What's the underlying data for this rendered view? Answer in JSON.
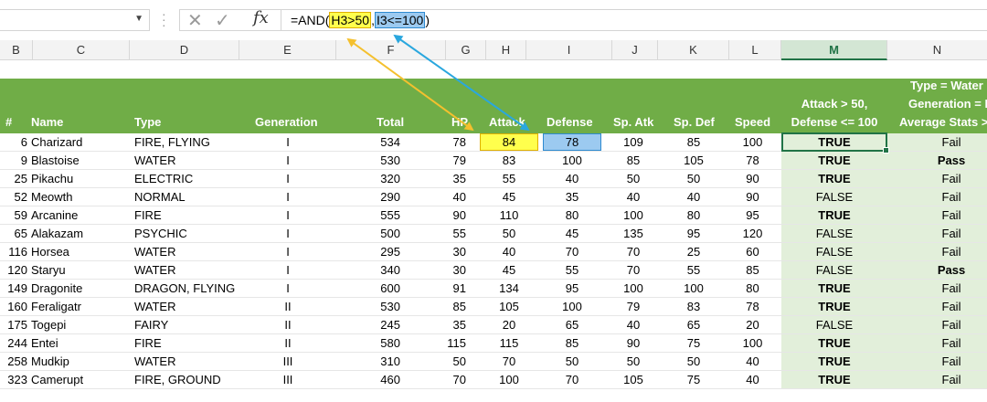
{
  "formula_bar": {
    "name_box": "",
    "formula_prefix": "=AND(",
    "ref1": "H3>50",
    "sep": ",",
    "ref2": "I3<=100",
    "formula_suffix": ")",
    "cancel_icon": "cancel-icon",
    "enter_icon": "checkmark-icon",
    "fx_label": "fx"
  },
  "columns": [
    "B",
    "C",
    "D",
    "E",
    "F",
    "G",
    "H",
    "I",
    "J",
    "K",
    "L",
    "M",
    "N"
  ],
  "header": {
    "num": "#",
    "name": "Name",
    "type": "Type",
    "generation": "Generation",
    "total": "Total",
    "hp": "HP",
    "attack": "Attack",
    "defense": "Defense",
    "sp_atk": "Sp. Atk",
    "sp_def": "Sp. Def",
    "speed": "Speed",
    "m_line1": "Attack > 50,",
    "m_line2": "Defense <= 100",
    "n_line1": "Type = Water",
    "n_line2": "Generation = I",
    "n_line3": "Average Stats >"
  },
  "rows": [
    {
      "num": "6",
      "name": "Charizard",
      "type": "FIRE, FLYING",
      "gen": "I",
      "total": "534",
      "hp": "78",
      "atk": "84",
      "def": "78",
      "spatk": "109",
      "spdef": "85",
      "speed": "100",
      "m": "TRUE",
      "n": "Fail"
    },
    {
      "num": "9",
      "name": "Blastoise",
      "type": "WATER",
      "gen": "I",
      "total": "530",
      "hp": "79",
      "atk": "83",
      "def": "100",
      "spatk": "85",
      "spdef": "105",
      "speed": "78",
      "m": "TRUE",
      "n": "Pass"
    },
    {
      "num": "25",
      "name": "Pikachu",
      "type": "ELECTRIC",
      "gen": "I",
      "total": "320",
      "hp": "35",
      "atk": "55",
      "def": "40",
      "spatk": "50",
      "spdef": "50",
      "speed": "90",
      "m": "TRUE",
      "n": "Fail"
    },
    {
      "num": "52",
      "name": "Meowth",
      "type": "NORMAL",
      "gen": "I",
      "total": "290",
      "hp": "40",
      "atk": "45",
      "def": "35",
      "spatk": "40",
      "spdef": "40",
      "speed": "90",
      "m": "FALSE",
      "n": "Fail"
    },
    {
      "num": "59",
      "name": "Arcanine",
      "type": "FIRE",
      "gen": "I",
      "total": "555",
      "hp": "90",
      "atk": "110",
      "def": "80",
      "spatk": "100",
      "spdef": "80",
      "speed": "95",
      "m": "TRUE",
      "n": "Fail"
    },
    {
      "num": "65",
      "name": "Alakazam",
      "type": "PSYCHIC",
      "gen": "I",
      "total": "500",
      "hp": "55",
      "atk": "50",
      "def": "45",
      "spatk": "135",
      "spdef": "95",
      "speed": "120",
      "m": "FALSE",
      "n": "Fail"
    },
    {
      "num": "116",
      "name": "Horsea",
      "type": "WATER",
      "gen": "I",
      "total": "295",
      "hp": "30",
      "atk": "40",
      "def": "70",
      "spatk": "70",
      "spdef": "25",
      "speed": "60",
      "m": "FALSE",
      "n": "Fail"
    },
    {
      "num": "120",
      "name": "Staryu",
      "type": "WATER",
      "gen": "I",
      "total": "340",
      "hp": "30",
      "atk": "45",
      "def": "55",
      "spatk": "70",
      "spdef": "55",
      "speed": "85",
      "m": "FALSE",
      "n": "Pass"
    },
    {
      "num": "149",
      "name": "Dragonite",
      "type": "DRAGON, FLYING",
      "gen": "I",
      "total": "600",
      "hp": "91",
      "atk": "134",
      "def": "95",
      "spatk": "100",
      "spdef": "100",
      "speed": "80",
      "m": "TRUE",
      "n": "Fail"
    },
    {
      "num": "160",
      "name": "Feraligatr",
      "type": "WATER",
      "gen": "II",
      "total": "530",
      "hp": "85",
      "atk": "105",
      "def": "100",
      "spatk": "79",
      "spdef": "83",
      "speed": "78",
      "m": "TRUE",
      "n": "Fail"
    },
    {
      "num": "175",
      "name": "Togepi",
      "type": "FAIRY",
      "gen": "II",
      "total": "245",
      "hp": "35",
      "atk": "20",
      "def": "65",
      "spatk": "40",
      "spdef": "65",
      "speed": "20",
      "m": "FALSE",
      "n": "Fail"
    },
    {
      "num": "244",
      "name": "Entei",
      "type": "FIRE",
      "gen": "II",
      "total": "580",
      "hp": "115",
      "atk": "115",
      "def": "85",
      "spatk": "90",
      "spdef": "75",
      "speed": "100",
      "m": "TRUE",
      "n": "Fail"
    },
    {
      "num": "258",
      "name": "Mudkip",
      "type": "WATER",
      "gen": "III",
      "total": "310",
      "hp": "50",
      "atk": "70",
      "def": "50",
      "spatk": "50",
      "spdef": "50",
      "speed": "40",
      "m": "TRUE",
      "n": "Fail"
    },
    {
      "num": "323",
      "name": "Camerupt",
      "type": "FIRE, GROUND",
      "gen": "III",
      "total": "460",
      "hp": "70",
      "atk": "100",
      "def": "70",
      "spatk": "105",
      "spdef": "75",
      "speed": "40",
      "m": "TRUE",
      "n": "Fail"
    }
  ],
  "colors": {
    "header_green": "#70ad47",
    "result_fill": "#e2efda",
    "ref1": "#ffff4d",
    "ref2": "#9ccaf0",
    "active_border": "#217346"
  }
}
